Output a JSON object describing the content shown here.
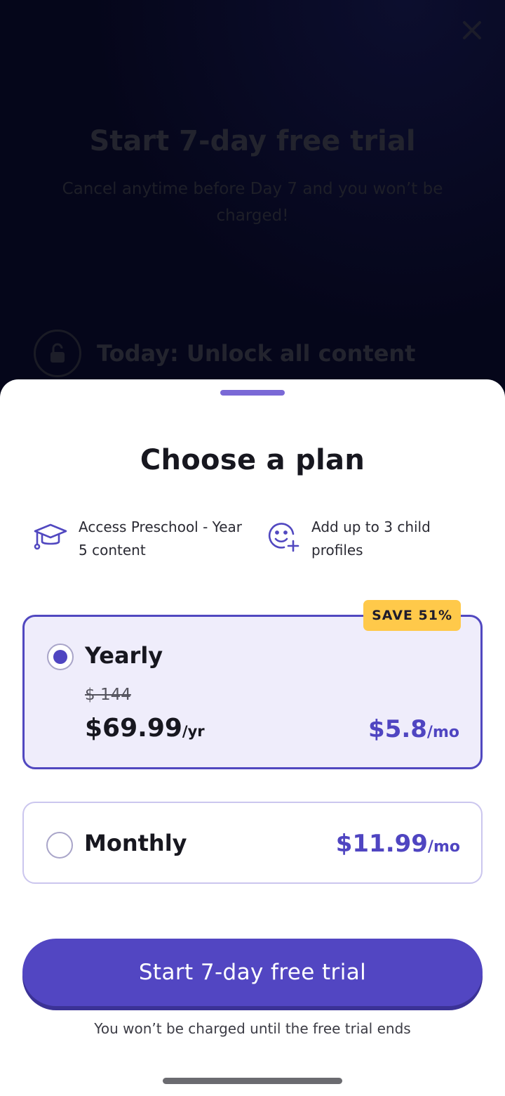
{
  "background_screen": {
    "title": "Start 7-day free trial",
    "subtitle": "Cancel anytime before Day 7 and you won’t be charged!",
    "step_label": "Today: Unlock all content"
  },
  "sheet": {
    "title": "Choose a plan",
    "features": [
      {
        "icon": "graduation-cap-icon",
        "text": "Access Preschool - Year 5 content"
      },
      {
        "icon": "add-profile-smiley-icon",
        "text": "Add up to 3 child profiles"
      }
    ],
    "plans": {
      "yearly": {
        "badge": "SAVE 51%",
        "name": "Yearly",
        "original_price": "$ 144",
        "price": "$69.99",
        "price_unit": "/yr",
        "monthly_equiv": "$5.8",
        "monthly_equiv_unit": "/mo",
        "selected": true
      },
      "monthly": {
        "name": "Monthly",
        "price": "$11.99",
        "price_unit": "/mo",
        "selected": false
      }
    },
    "cta_label": "Start 7-day free trial",
    "cta_note": "You won’t be charged until the free trial ends"
  },
  "colors": {
    "accent": "#5246c2",
    "badge": "#ffc94a",
    "selected_card_bg": "#efedfb",
    "overlay_bg": "#05061a"
  }
}
